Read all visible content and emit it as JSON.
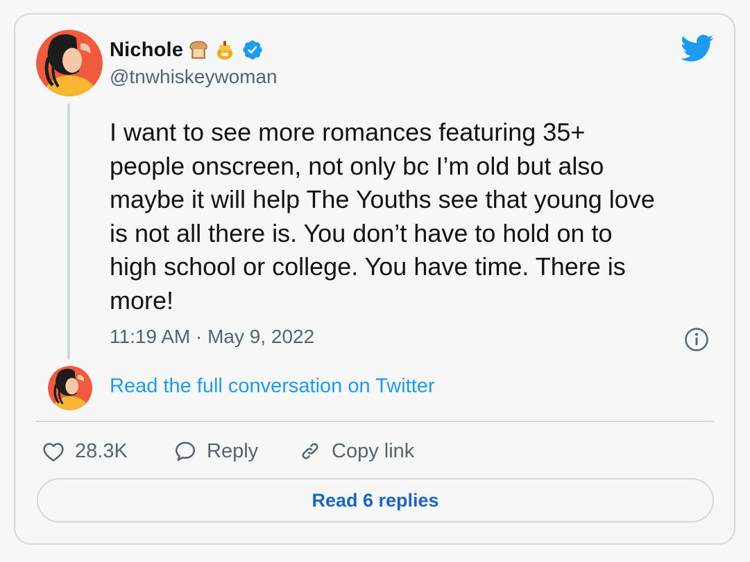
{
  "user": {
    "display_name": "Nichole",
    "name_emojis": [
      "bread-emoji",
      "honey-pot-emoji"
    ],
    "handle": "@tnwhiskeywoman",
    "verified": true
  },
  "tweet": {
    "text": "I want to see more romances featuring 35+\npeople onscreen, not only bc I’m old but also\nmaybe it will help The Youths see that young love\nis not all there is. You don’t have to hold on to\nhigh school or college. You have time. There is\nmore!",
    "timestamp": "11:19 AM · May 9, 2022"
  },
  "conversation_link": "Read the full conversation on Twitter",
  "actions": {
    "like_count": "28.3K",
    "reply_label": "Reply",
    "copy_link_label": "Copy link"
  },
  "replies_button": "Read 6 replies",
  "colors": {
    "accent": "#1d9bf0",
    "button_text": "#1a66c0",
    "secondary_text": "#536471",
    "border": "#cfd9de",
    "avatar_bg": "#f05a3c"
  }
}
